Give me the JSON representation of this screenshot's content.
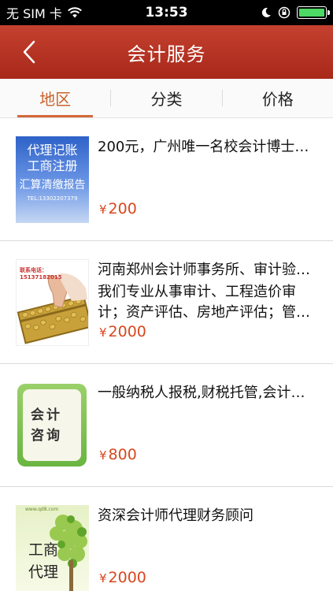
{
  "status_bar": {
    "carrier": "无 SIM 卡",
    "time": "13:53"
  },
  "nav": {
    "title": "会计服务"
  },
  "tabs": [
    {
      "label": "地区",
      "active": true
    },
    {
      "label": "分类",
      "active": false
    },
    {
      "label": "价格",
      "active": false
    }
  ],
  "currency_symbol": "¥",
  "items": [
    {
      "title": "200元，广州唯一名校会计博士…",
      "desc": "",
      "price": "200",
      "thumb_text": [
        "代理记账",
        "工商注册",
        "汇算清缴报告",
        "TEL:13302207379"
      ]
    },
    {
      "title": "河南郑州会计师事务所、审计验…",
      "desc": "我们专业从事审计、工程造价审计；资产评估、房地产评估；管…",
      "price": "2000",
      "thumb_text": [
        "联系电话：15137182015"
      ]
    },
    {
      "title": "一般纳税人报税,财税托管,会计…",
      "desc": "",
      "price": "800",
      "thumb_text": [
        "会计",
        "咨询"
      ]
    },
    {
      "title": "资深会计师代理财务顾问",
      "desc": "",
      "price": "2000",
      "thumb_text": [
        "www.qd8.com",
        "工商",
        "代理"
      ]
    }
  ],
  "colors": {
    "nav_bg": "#b3321f",
    "accent": "#d4683a",
    "price": "#d8471e"
  }
}
